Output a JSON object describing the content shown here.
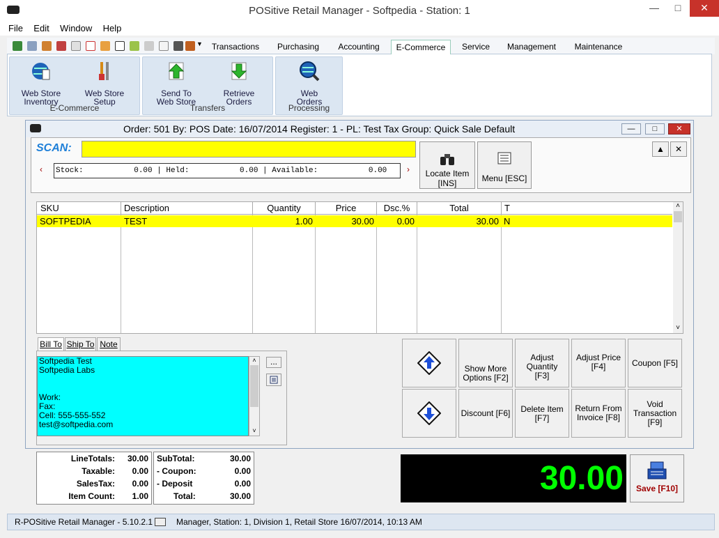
{
  "window": {
    "title": "POSitive Retail Manager - Softpedia - Station: 1"
  },
  "menu": [
    "File",
    "Edit",
    "Window",
    "Help"
  ],
  "ribbon_tabs": [
    "Transactions",
    "Purchasing",
    "Accounting",
    "E-Commerce",
    "Service",
    "Management",
    "Maintenance"
  ],
  "ribbon_active_tab": "E-Commerce",
  "ribbon_groups": [
    {
      "label": "E-Commerce",
      "buttons": [
        {
          "l1": "Web Store",
          "l2": "Inventory",
          "icon": "globe-icon"
        },
        {
          "l1": "Web Store",
          "l2": "Setup",
          "icon": "tools-icon"
        }
      ]
    },
    {
      "label": "Transfers",
      "buttons": [
        {
          "l1": "Send To",
          "l2": "Web Store",
          "icon": "up-arrow-icon"
        },
        {
          "l1": "Retrieve",
          "l2": "Orders",
          "icon": "down-arrow-icon"
        }
      ]
    },
    {
      "label": "Processing",
      "buttons": [
        {
          "l1": "Web",
          "l2": "Orders",
          "icon": "globe-search-icon"
        }
      ]
    }
  ],
  "order_window": {
    "title": "Order: 501  By: POS  Date: 16/07/2014  Register: 1 - PL: Test  Tax Group: Quick Sale Default",
    "scan_label": "SCAN:",
    "stock_line": "Stock:           0.00 | Held:           0.00 | Available:           0.00",
    "locate_item_l1": "Locate Item",
    "locate_item_l2": "[INS]",
    "menu_label": "Menu [ESC]"
  },
  "grid": {
    "headers": [
      "SKU",
      "Description",
      "Quantity",
      "Price",
      "Dsc.%",
      "Total",
      "T"
    ],
    "rows": [
      {
        "sku": "SOFTPEDIA",
        "description": "TEST",
        "quantity": "1.00",
        "price": "30.00",
        "dsc": "0.00",
        "total": "30.00",
        "t": "N"
      }
    ]
  },
  "address_tabs": [
    "Bill To",
    "Ship To",
    "Note"
  ],
  "bill_to_lines": [
    "Softpedia Test",
    "Softpedia Labs",
    "",
    "",
    "Work:",
    "Fax:",
    "Cell: 555-555-552",
    "test@softpedia.com"
  ],
  "actions": {
    "show_more_1": "Show More",
    "show_more_2": "Options [F2]",
    "adjust_qty_1": "Adjust Quantity",
    "adjust_qty_2": "[F3]",
    "adjust_price": "Adjust Price [F4]",
    "coupon": "Coupon [F5]",
    "discount": "Discount [F6]",
    "delete_item": "Delete Item [F7]",
    "return_1": "Return From",
    "return_2": "Invoice [F8]",
    "void_1": "Void",
    "void_2": "Transaction [F9]"
  },
  "totals_left": [
    {
      "k": "LineTotals:",
      "v": "30.00"
    },
    {
      "k": "Taxable:",
      "v": "0.00"
    },
    {
      "k": "SalesTax:",
      "v": "0.00"
    },
    {
      "k": "Item Count:",
      "v": "1.00"
    }
  ],
  "totals_right": [
    {
      "k": "SubTotal:",
      "v": "30.00"
    },
    {
      "k": "- Coupon:",
      "v": "0.00"
    },
    {
      "k": "- Deposit",
      "v": "0.00"
    },
    {
      "k": "Total:",
      "v": "30.00"
    }
  ],
  "display_total": "30.00",
  "save_label": "Save [F10]",
  "status": {
    "app": "R-POSitive Retail Manager - 5.10.2.1",
    "info": "Manager, Station: 1, Division 1, Retail Store  16/07/2014, 10:13 AM"
  },
  "colors": {
    "scan": "#ffff00",
    "address": "#00ffff",
    "display_text": "#00ff00",
    "accent": "#1e7fd8"
  }
}
